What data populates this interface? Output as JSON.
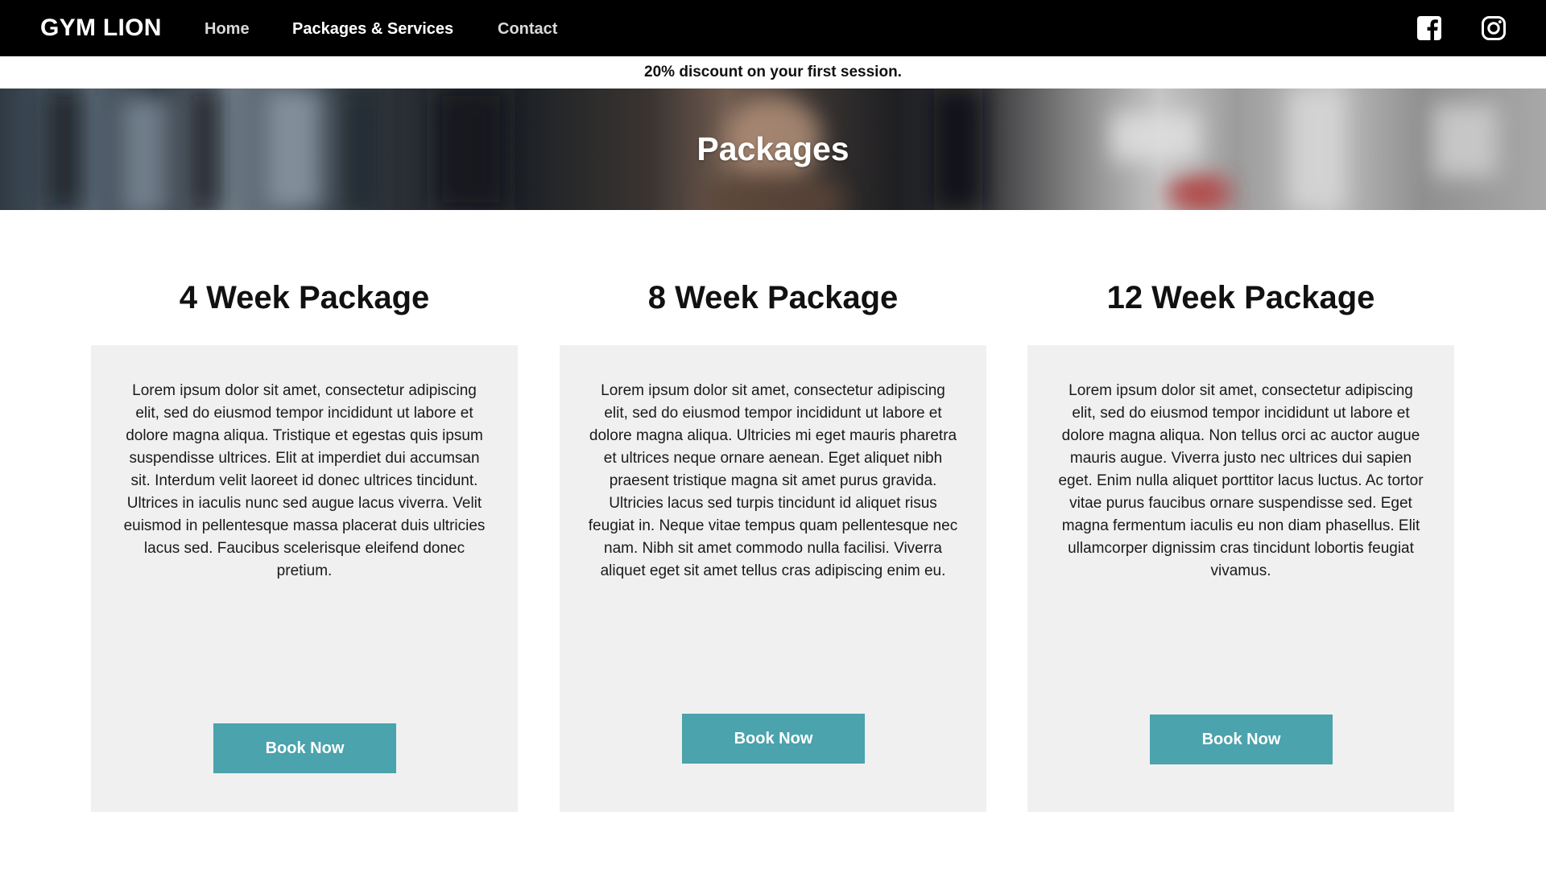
{
  "nav": {
    "brand": "GYM LION",
    "links": [
      "Home",
      "Packages & Services",
      "Contact"
    ],
    "social": [
      "facebook-icon",
      "instagram-icon"
    ]
  },
  "promo": "20% discount on your first session.",
  "hero": {
    "title": "Packages"
  },
  "packages": [
    {
      "title": "4 Week Package",
      "description": "Lorem ipsum dolor sit amet, consectetur adipiscing elit, sed do eiusmod tempor incididunt ut labore et dolore magna aliqua. Tristique et egestas quis ipsum suspendisse ultrices. Elit at imperdiet dui accumsan sit. Interdum velit laoreet id donec ultrices tincidunt. Ultrices in iaculis nunc sed augue lacus viverra. Velit euismod in pellentesque massa placerat duis ultricies lacus sed. Faucibus scelerisque eleifend donec pretium.",
      "button": "Book Now"
    },
    {
      "title": "8 Week Package",
      "description": "Lorem ipsum dolor sit amet, consectetur adipiscing elit, sed do eiusmod tempor incididunt ut labore et dolore magna aliqua. Ultricies mi eget mauris pharetra et ultrices neque ornare aenean. Eget aliquet nibh praesent tristique magna sit amet purus gravida. Ultricies lacus sed turpis tincidunt id aliquet risus feugiat in. Neque vitae tempus quam pellentesque nec nam. Nibh sit amet commodo nulla facilisi. Viverra aliquet eget sit amet tellus cras adipiscing enim eu.",
      "button": "Book Now"
    },
    {
      "title": "12 Week Package",
      "description": "Lorem ipsum dolor sit amet, consectetur adipiscing elit, sed do eiusmod tempor incididunt ut labore et dolore magna aliqua. Non tellus orci ac auctor augue mauris augue. Viverra justo nec ultrices dui sapien eget. Enim nulla aliquet porttitor lacus luctus. Ac tortor vitae purus faucibus ornare suspendisse sed. Eget magna fermentum iaculis eu non diam phasellus. Elit ullamcorper dignissim cras tincidunt lobortis feugiat vivamus.",
      "button": "Book Now"
    }
  ],
  "colors": {
    "navbar": "#000000",
    "accent": "#4aa3ad",
    "card": "#f0f0f0"
  }
}
